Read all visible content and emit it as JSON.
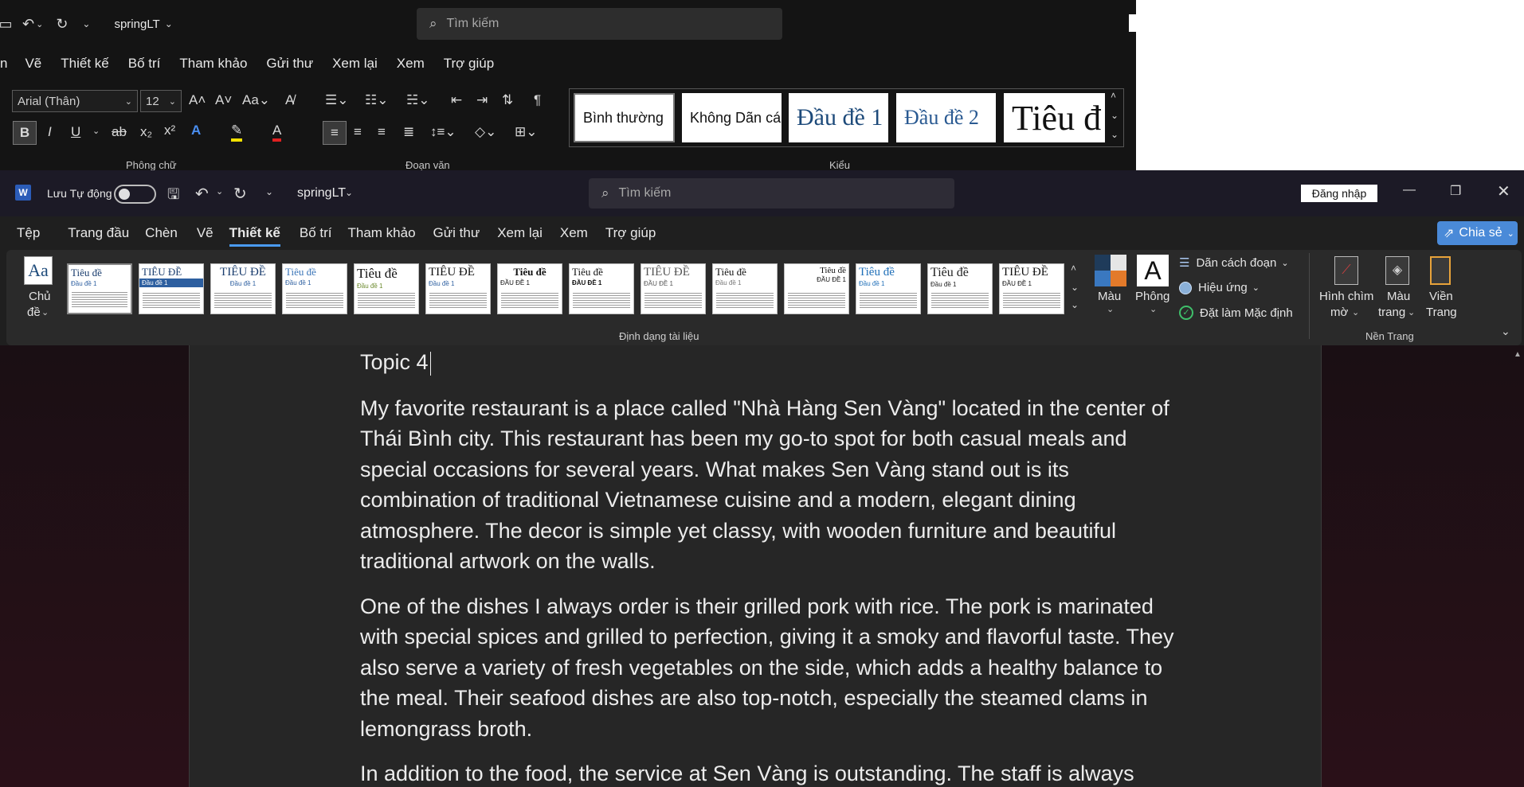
{
  "back_window": {
    "doc_title": "springLT",
    "search_placeholder": "Tìm kiếm",
    "menu": [
      "n",
      "Vẽ",
      "Thiết kế",
      "Bố trí",
      "Tham khảo",
      "Gửi thư",
      "Xem lại",
      "Xem",
      "Trợ giúp"
    ],
    "font_name": "Arial (Thân)",
    "font_size": "12",
    "styles": [
      "Bình thường",
      "Không Dãn cá",
      "Đầu đề 1",
      "Đầu đề 2",
      "Tiêu đ"
    ],
    "groups": {
      "font": "Phông chữ",
      "paragraph": "Đoạn văn",
      "styles": "Kiểu"
    }
  },
  "front_window": {
    "app_icon": "W",
    "autosave_label": "Lưu Tự động",
    "autosave_state": "off",
    "doc_title": "springLT",
    "search_placeholder": "Tìm kiếm",
    "signin_label": "Đăng nhập",
    "share_label": "Chia sẻ",
    "menu": [
      {
        "label": "Tệp",
        "active": false
      },
      {
        "label": "Trang đầu",
        "active": false
      },
      {
        "label": "Chèn",
        "active": false
      },
      {
        "label": "Vẽ",
        "active": false
      },
      {
        "label": "Thiết kế",
        "active": true
      },
      {
        "label": "Bố trí",
        "active": false
      },
      {
        "label": "Tham khảo",
        "active": false
      },
      {
        "label": "Gửi thư",
        "active": false
      },
      {
        "label": "Xem lại",
        "active": false
      },
      {
        "label": "Xem",
        "active": false
      },
      {
        "label": "Trợ giúp",
        "active": false
      }
    ],
    "ribbon": {
      "themes_label_1": "Chủ",
      "themes_label_2": "đề",
      "theme_thumbs": [
        {
          "title": "Tiêu đề",
          "heading": "Đầu đề 1"
        },
        {
          "title": "TIÊU ĐỀ",
          "heading": "Đầu đề 1"
        },
        {
          "title": "TIÊU ĐỀ",
          "heading": "Đầu đề 1"
        },
        {
          "title": "Tiêu đề",
          "heading": "Đầu đề 1"
        },
        {
          "title": "Tiêu đề",
          "heading": "Đầu đề 1"
        },
        {
          "title": "TIÊU ĐỀ",
          "heading": "Đầu đề 1"
        },
        {
          "title": "Tiêu đề",
          "heading": "ĐẦU ĐỀ 1"
        },
        {
          "title": "Tiêu đề",
          "heading": "ĐẦU ĐỀ 1"
        },
        {
          "title": "TIÊU ĐỀ",
          "heading": "ĐẦU ĐỀ 1"
        },
        {
          "title": "Tiêu đề",
          "heading": "Đầu đề 1"
        },
        {
          "title": "Tiêu đề",
          "heading": "ĐẦU ĐỀ 1"
        },
        {
          "title": "Tiêu đề",
          "heading": "Đầu đề 1"
        },
        {
          "title": "Tiêu đề",
          "heading": "Đầu đề 1"
        },
        {
          "title": "TIÊU ĐỀ",
          "heading": "ĐẦU ĐỀ 1"
        }
      ],
      "colors_label": "Màu",
      "fonts_label": "Phông",
      "paragraph_spacing": "Dãn cách đoạn",
      "effects": "Hiệu ứng",
      "set_default": "Đặt làm Mặc định",
      "watermark_1": "Hình chìm",
      "watermark_2": "mờ",
      "page_color_1": "Màu",
      "page_color_2": "trang",
      "page_border_1": "Viền",
      "page_border_2": "Trang",
      "group_doc_format": "Định dạng tài liệu",
      "group_page_bg": "Nền Trang"
    }
  },
  "document": {
    "heading": "Topic 4",
    "paragraphs": [
      "My favorite restaurant is a place called \"Nhà Hàng Sen Vàng\" located in the center of Thái Bình city. This restaurant has been my go-to spot for both casual meals and special occasions for several years. What makes Sen Vàng stand out is its combination of traditional Vietnamese cuisine and a modern, elegant dining atmosphere. The decor is simple yet classy, with wooden furniture and beautiful traditional artwork on the walls.",
      "One of the dishes I always order is their grilled pork with rice. The pork is marinated with special spices and grilled to perfection, giving it a smoky and flavorful taste. They also serve a variety of fresh vegetables on the side, which adds a healthy balance to the meal. Their seafood dishes are also top-notch, especially the steamed clams in lemongrass broth.",
      "In addition to the food, the service at Sen Vàng is outstanding. The staff is always"
    ]
  },
  "colors": {
    "accent": "#3a7bd5",
    "share_bg": "#4a8ad8",
    "active_tab_underline": "#4a9af0"
  }
}
